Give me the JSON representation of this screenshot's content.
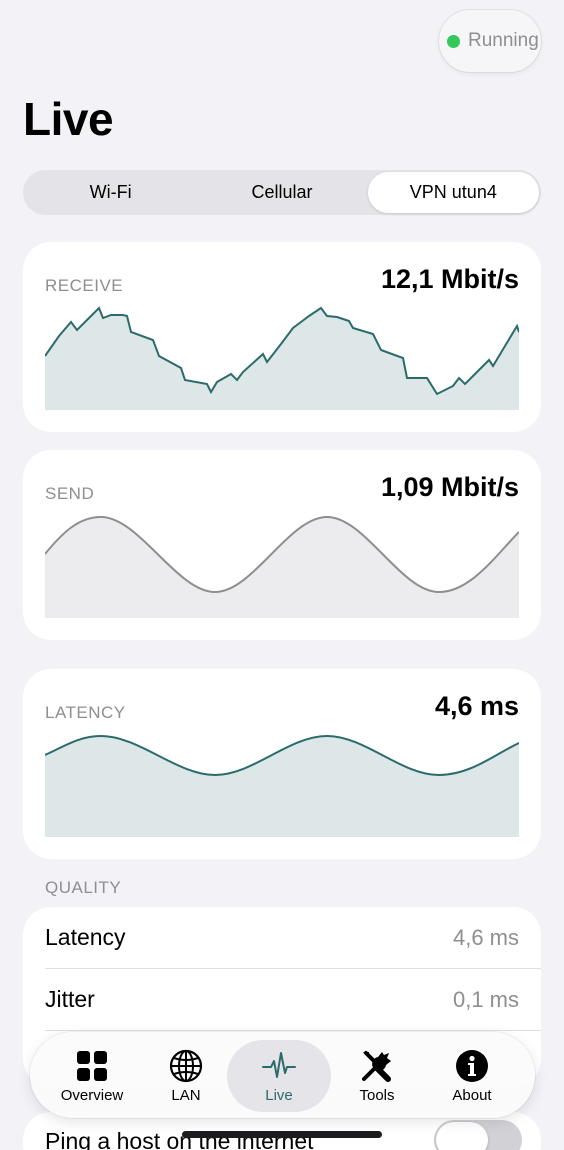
{
  "status": {
    "label": "Running",
    "color": "#34c759"
  },
  "page": {
    "title": "Live"
  },
  "segments": {
    "items": [
      "Wi-Fi",
      "Cellular",
      "VPN utun4"
    ],
    "selected": "VPN utun4"
  },
  "metrics": {
    "receive": {
      "label": "RECEIVE",
      "value": "12,1 Mbit/s",
      "color": "#2c6b6b"
    },
    "send": {
      "label": "SEND",
      "value": "1,09 Mbit/s",
      "color": "#8e8e8e"
    },
    "latency": {
      "label": "LATENCY",
      "value": "4,6 ms",
      "color": "#2c6b6b"
    }
  },
  "quality": {
    "header": "QUALITY",
    "rows": [
      {
        "label": "Latency",
        "value": "4,6 ms"
      },
      {
        "label": "Jitter",
        "value": "0,1 ms"
      }
    ]
  },
  "ping": {
    "label": "Ping a host on the internet",
    "toggle_on": false
  },
  "tabbar": {
    "items": [
      {
        "label": "Overview",
        "icon": "grid-icon"
      },
      {
        "label": "LAN",
        "icon": "globe-icon"
      },
      {
        "label": "Live",
        "icon": "pulse-icon"
      },
      {
        "label": "Tools",
        "icon": "tools-icon"
      },
      {
        "label": "About",
        "icon": "info-icon"
      }
    ],
    "active": "Live",
    "accent": "#2c6b6b"
  }
}
